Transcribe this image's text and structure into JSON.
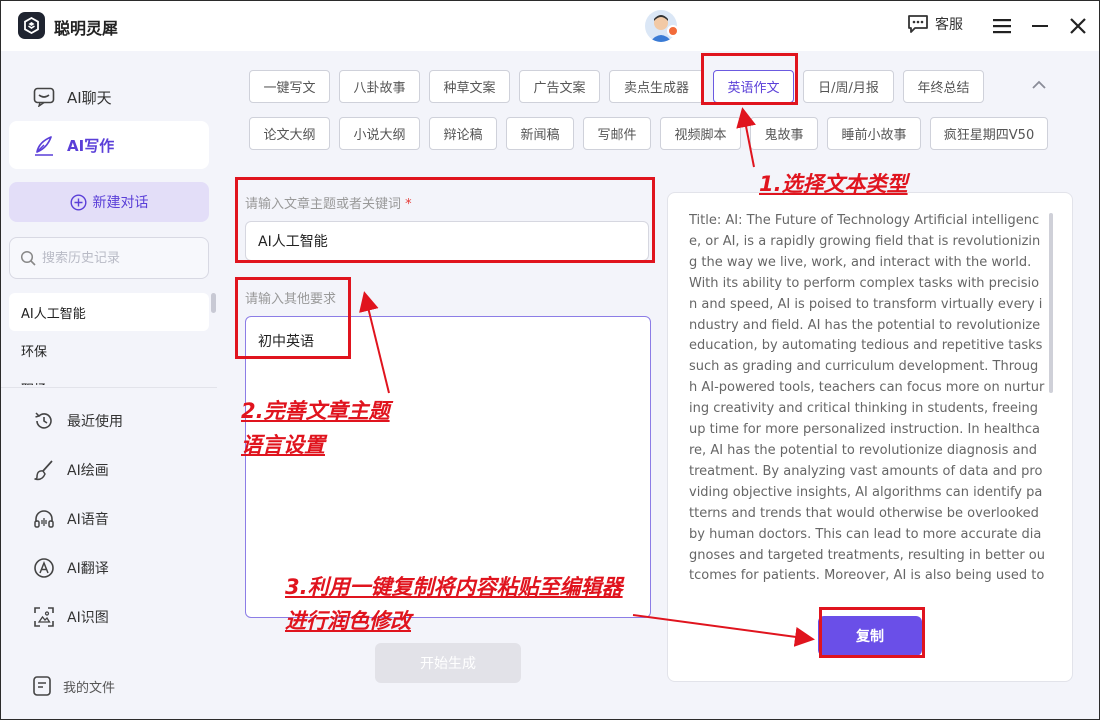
{
  "app": {
    "title": "聪明灵犀"
  },
  "titlebar": {
    "service_label": "客服"
  },
  "sidebar": {
    "nav": [
      {
        "label": "AI聊天"
      },
      {
        "label": "AI写作"
      }
    ],
    "new_chat_label": "新建对话",
    "search_placeholder": "搜索历史记录",
    "history": [
      "AI人工智能",
      "环保",
      "职场"
    ],
    "tools": [
      {
        "label": "最近使用"
      },
      {
        "label": "AI绘画"
      },
      {
        "label": "AI语音"
      },
      {
        "label": "AI翻译"
      },
      {
        "label": "AI识图"
      }
    ],
    "my_files_label": "我的文件"
  },
  "tags": {
    "row1": [
      "一键写文",
      "八卦故事",
      "种草文案",
      "广告文案",
      "卖点生成器",
      "英语作文",
      "日/周/月报",
      "年终总结"
    ],
    "row2": [
      "论文大纲",
      "小说大纲",
      "辩论稿",
      "新闻稿",
      "写邮件",
      "视频脚本",
      "鬼故事",
      "睡前小故事",
      "疯狂星期四V50"
    ],
    "selected": "英语作文"
  },
  "form": {
    "topic_label": "请输入文章主题或者关键词",
    "topic_required_mark": "*",
    "topic_value": "AI人工智能",
    "other_label": "请输入其他要求",
    "other_value": "初中英语",
    "generate_label": "开始生成"
  },
  "output": {
    "text": "Title: AI: The Future of Technology Artificial intelligence, or AI, is a rapidly growing field that is revolutionizing the way we live, work, and interact with the world. With its ability to perform complex tasks with precision and speed, AI is poised to transform virtually every industry and field. AI has the potential to revolutionize education, by automating tedious and repetitive tasks such as grading and curriculum development. Through AI-powered tools, teachers can focus more on nurturing creativity and critical thinking in students, freeing up time for more personalized instruction. In healthcare, AI has the potential to revolutionize diagnosis and treatment. By analyzing vast amounts of data and providing objective insights, AI algorithms can identify patterns and trends that would otherwise be overlooked by human doctors. This can lead to more accurate diagnoses and targeted treatments, resulting in better outcomes for patients. Moreover, AI is also being used to enhance human capabilities. Through voice recognition techn",
    "copy_label": "复制"
  },
  "annotations": {
    "step1": "1.选择文本类型",
    "step2_line1": "2.完善文章主题",
    "step2_line2": "语言设置",
    "step3_line1": "3.利用一键复制将内容粘贴至编辑器",
    "step3_line2": "进行润色修改"
  },
  "colors": {
    "accent": "#5a3fd8",
    "copy_button": "#6a4fe8",
    "annotation_red": "#e0141e"
  }
}
